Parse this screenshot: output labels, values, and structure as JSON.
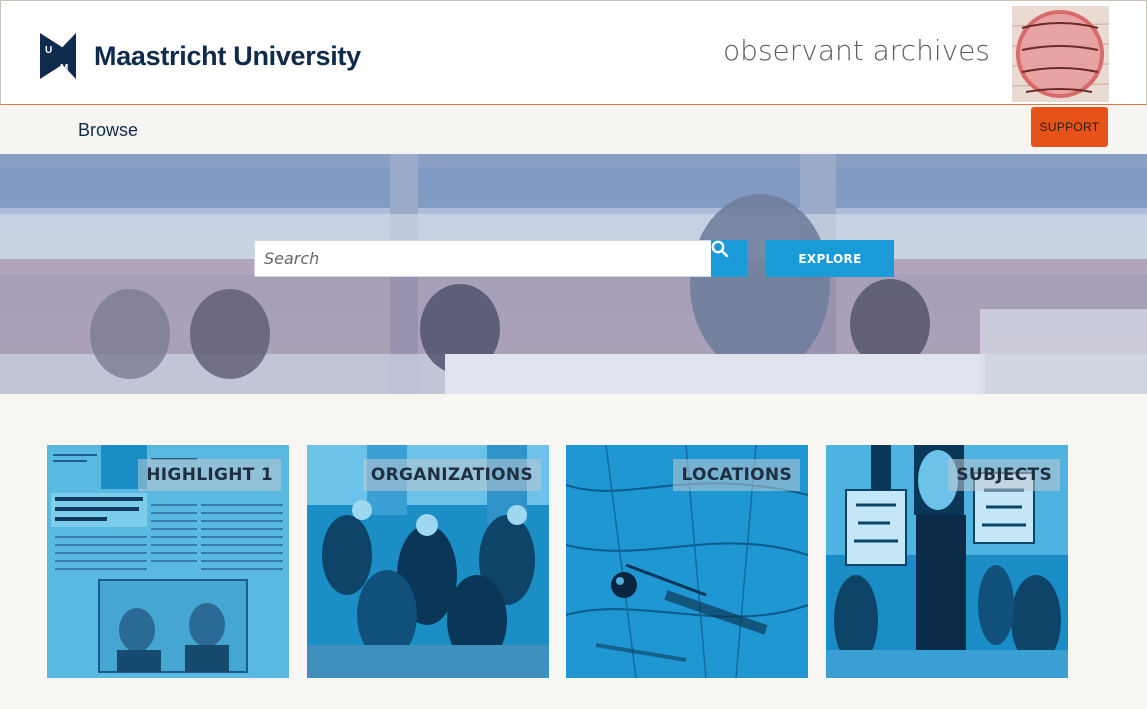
{
  "header": {
    "logo_text": "Maastricht University",
    "archive_title": "observant archives"
  },
  "nav": {
    "browse_label": "Browse",
    "support_label": "SUPPORT"
  },
  "hero": {
    "search_placeholder": "Search",
    "explore_label": "EXPLORE"
  },
  "tiles": [
    {
      "label": "HIGHLIGHT 1"
    },
    {
      "label": "ORGANIZATIONS"
    },
    {
      "label": "LOCATIONS"
    },
    {
      "label": "SUBJECTS"
    }
  ],
  "colors": {
    "brand_navy": "#0f2b4c",
    "accent_blue": "#1a9ad6",
    "support_orange": "#e5531a"
  },
  "icons": [
    "um-logo-icon",
    "search-icon"
  ]
}
